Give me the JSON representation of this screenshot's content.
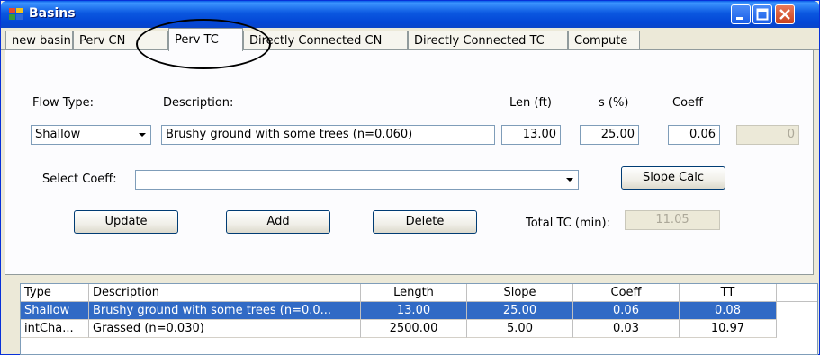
{
  "window": {
    "title": "Basins"
  },
  "tabs": [
    {
      "label": "new basin"
    },
    {
      "label": "Perv CN"
    },
    {
      "label": "Perv TC"
    },
    {
      "label": "Directly Connected CN"
    },
    {
      "label": "Directly Connected TC"
    },
    {
      "label": "Compute"
    }
  ],
  "form": {
    "flow_type_label": "Flow Type:",
    "flow_type_value": "Shallow",
    "description_label": "Description:",
    "description_value": "Brushy ground with some trees (n=0.060)",
    "len_label": "Len (ft)",
    "len_value": "13.00",
    "slope_label": "s (%)",
    "slope_value": "25.00",
    "coeff_label": "Coeff",
    "coeff_value": "0.06",
    "extra_value": "0",
    "select_coeff_label": "Select Coeff:",
    "select_coeff_value": "",
    "slope_calc_label": "Slope Calc",
    "update_label": "Update",
    "add_label": "Add",
    "delete_label": "Delete",
    "total_tc_label": "Total TC (min):",
    "total_tc_value": "11.05"
  },
  "table": {
    "headers": [
      "Type",
      "Description",
      "Length",
      "Slope",
      "Coeff",
      "TT"
    ],
    "rows": [
      {
        "type": "Shallow",
        "description": "Brushy ground with some trees (n=0.0...",
        "length": "13.00",
        "slope": "25.00",
        "coeff": "0.06",
        "tt": "0.08"
      },
      {
        "type": "intCha...",
        "description": "Grassed (n=0.030)",
        "length": "2500.00",
        "slope": "5.00",
        "coeff": "0.03",
        "tt": "10.97"
      }
    ]
  },
  "colors": {
    "titlebar": "#0b58e0",
    "selection": "#316ac5",
    "window_bg": "#ece9d8"
  }
}
